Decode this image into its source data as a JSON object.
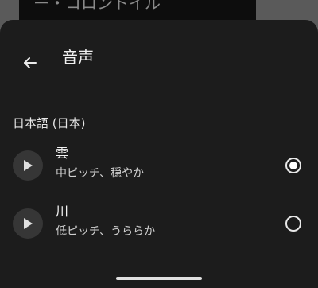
{
  "background_card": {
    "partial_text": "ー・コロントイル"
  },
  "sheet": {
    "title": "音声",
    "back_icon": "arrow-left-icon",
    "section": "日本語 (日本)",
    "voices": [
      {
        "name": "雲",
        "description": "中ピッチ、穏やか",
        "selected": true,
        "play_icon": "play-icon"
      },
      {
        "name": "川",
        "description": "低ピッチ、うららか",
        "selected": false,
        "play_icon": "play-icon"
      }
    ]
  },
  "colors": {
    "sheet_background": "#1c1c1c",
    "scrim": "#5a5a5a",
    "play_button": "#363636",
    "text_primary": "#f2f2f2",
    "text_secondary": "#cfcfcf"
  }
}
